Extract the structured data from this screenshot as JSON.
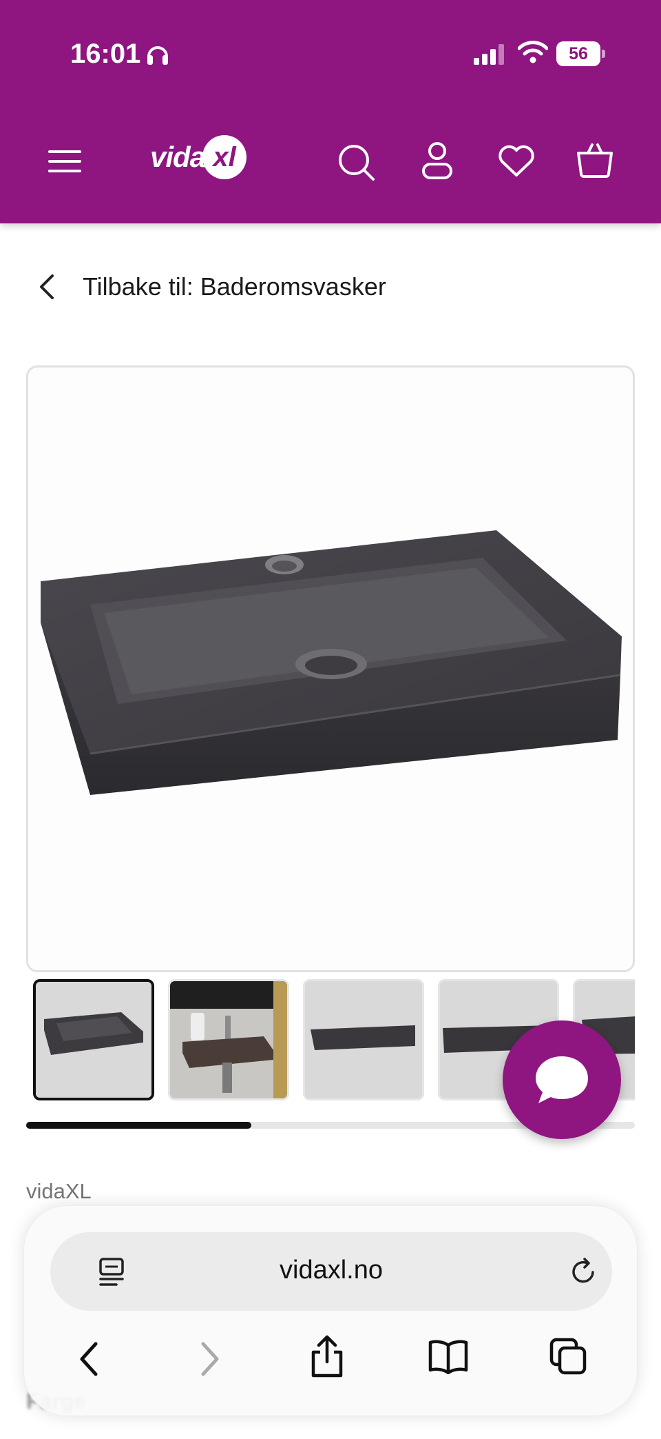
{
  "status_bar": {
    "time": "16:01",
    "battery": "56"
  },
  "header": {
    "logo_main": "vida",
    "logo_badge": "xl",
    "colors": {
      "brand": "#8f1580"
    },
    "icons": [
      "menu-icon",
      "search-icon",
      "account-icon",
      "heart-icon",
      "basket-icon"
    ]
  },
  "back_link": {
    "label": "Tilbake til: Baderomsvasker"
  },
  "gallery": {
    "thumbnail_count_visible": 5,
    "selected_index": 0,
    "scroll_progress": 0.37
  },
  "product": {
    "brand": "vidaXL",
    "color_label": "Farge"
  },
  "browser": {
    "url": "vidaxl.no",
    "icons": [
      "reader-icon",
      "reload-icon",
      "back-icon",
      "forward-icon",
      "share-icon",
      "bookmarks-icon",
      "tabs-icon"
    ]
  }
}
